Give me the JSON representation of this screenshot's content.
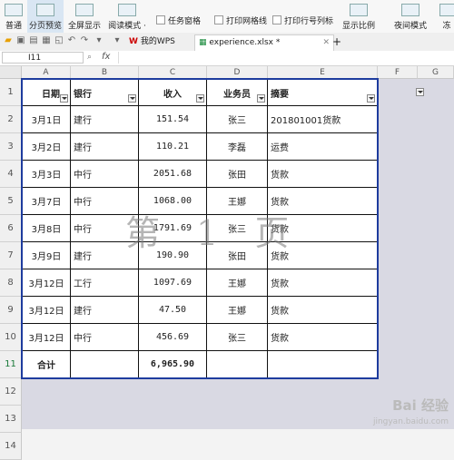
{
  "ribbon": {
    "buttons": [
      {
        "label": "普通"
      },
      {
        "label": "分页预览"
      },
      {
        "label": "全屏显示"
      },
      {
        "label": "阅读模式 ·"
      },
      {
        "label": "显示比例"
      },
      {
        "label": "夜间模式"
      },
      {
        "label": "冻"
      }
    ],
    "checkboxes": [
      {
        "label": "任务窗格"
      },
      {
        "label": "打印网格线"
      },
      {
        "label": "打印行号列标"
      }
    ]
  },
  "tabs": {
    "home": "我的WPS",
    "file": "experience.xlsx *",
    "add": "+"
  },
  "formula_bar": {
    "cell_ref": "I11",
    "fx": "fx"
  },
  "columns": [
    "A",
    "B",
    "C",
    "D",
    "E",
    "F",
    "G"
  ],
  "rows": [
    "1",
    "2",
    "3",
    "4",
    "5",
    "6",
    "7",
    "8",
    "9",
    "10",
    "11",
    "12",
    "13",
    "14"
  ],
  "table": {
    "headers": [
      "日期",
      "银行",
      "收入",
      "业务员",
      "摘要"
    ],
    "rows": [
      [
        "3月1日",
        "建行",
        "151.54",
        "张三",
        "201801001货款"
      ],
      [
        "3月2日",
        "建行",
        "110.21",
        "李磊",
        "运费"
      ],
      [
        "3月3日",
        "中行",
        "2051.68",
        "张田",
        "货款"
      ],
      [
        "3月7日",
        "中行",
        "1068.00",
        "王娜",
        "货款"
      ],
      [
        "3月8日",
        "中行",
        "1791.69",
        "张三",
        "货款"
      ],
      [
        "3月9日",
        "建行",
        "190.90",
        "张田",
        "货款"
      ],
      [
        "3月12日",
        "工行",
        "1097.69",
        "王娜",
        "货款"
      ],
      [
        "3月12日",
        "建行",
        "47.50",
        "王娜",
        "货款"
      ],
      [
        "3月12日",
        "中行",
        "456.69",
        "张三",
        "货款"
      ]
    ],
    "total_label": "合计",
    "total_value": "6,965.90"
  },
  "watermark": "第 1 页",
  "branding": {
    "logo": "Bai 经验",
    "url": "jingyan.baidu.com"
  }
}
